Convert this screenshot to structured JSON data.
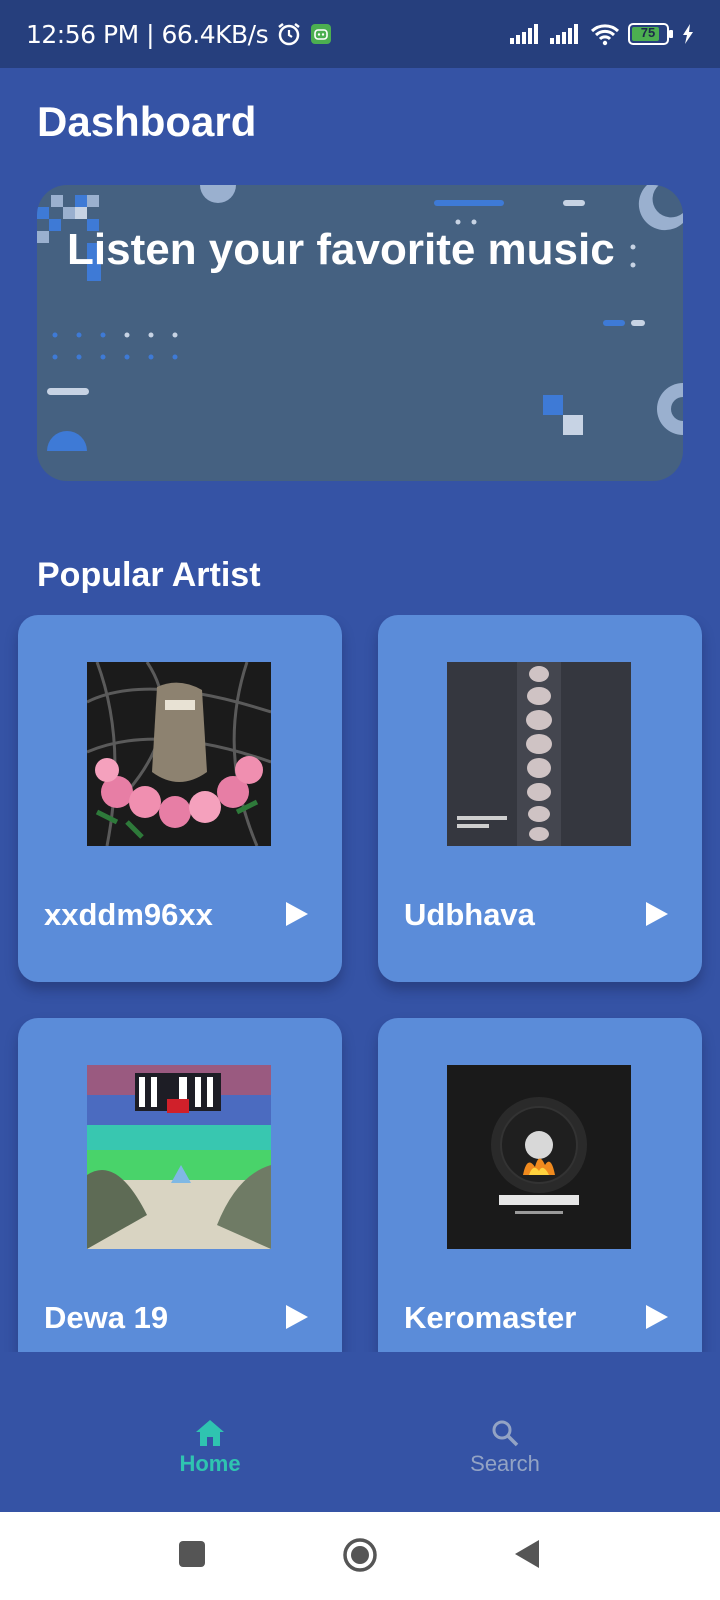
{
  "status_bar": {
    "time": "12:56 PM | 66.4KB/s",
    "battery": "75",
    "icons": [
      "alarm-icon",
      "robot-icon",
      "signal-icon",
      "signal-icon",
      "wifi-icon",
      "battery-icon",
      "charging-icon"
    ]
  },
  "page": {
    "title": "Dashboard"
  },
  "banner": {
    "text": "Listen your favorite music"
  },
  "section": {
    "title": "Popular Artist"
  },
  "artists": [
    {
      "name": "xxddm96xx",
      "art": "album-art-roses-mask"
    },
    {
      "name": "Udbhava",
      "art": "album-art-udbhava-dewa"
    },
    {
      "name": "Dewa 19",
      "art": "album-art-dewa-19"
    },
    {
      "name": "Keromaster",
      "art": "album-art-kerozene"
    }
  ],
  "nav": {
    "items": [
      {
        "label": "Home",
        "icon": "home-icon",
        "active": true
      },
      {
        "label": "Search",
        "icon": "search-icon",
        "active": false
      }
    ]
  },
  "system_nav": {
    "icons": [
      "recents-icon",
      "home-circle-icon",
      "back-icon"
    ]
  },
  "colors": {
    "background": "#3553a5",
    "status_bar": "#263f7d",
    "banner": "#456181",
    "card": "#5b8cd9",
    "active_nav": "#2fc4b0"
  }
}
